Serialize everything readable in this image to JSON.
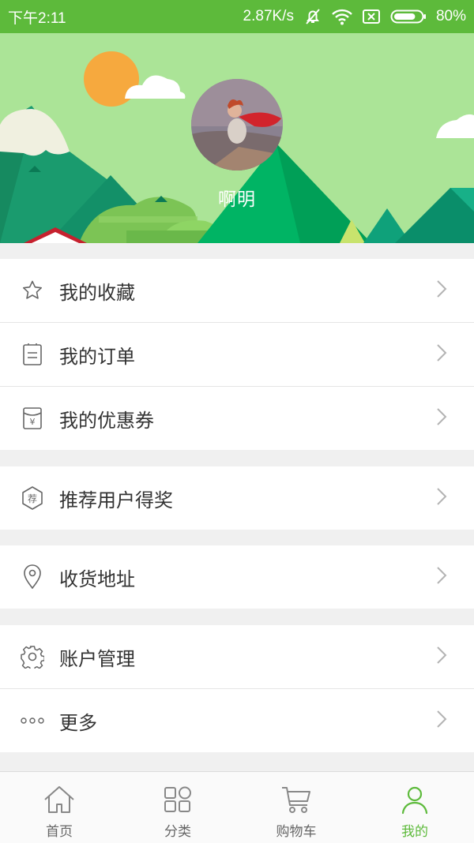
{
  "status_bar": {
    "time": "下午2:11",
    "network_speed": "2.87K/s",
    "battery": "80%",
    "battery_level": 0.8
  },
  "profile": {
    "username": "啊明"
  },
  "menu": {
    "favorites": "我的收藏",
    "orders": "我的订单",
    "coupons": "我的优惠券",
    "coupon_icon_char": "¥",
    "referral": "推荐用户得奖",
    "referral_icon_char": "荐",
    "address": "收货地址",
    "account": "账户管理",
    "more": "更多"
  },
  "tabs": {
    "home": "首页",
    "category": "分类",
    "cart": "购物车",
    "mine": "我的"
  },
  "colors": {
    "accent": "#5dba3b",
    "header_bg": "#abe497",
    "text": "#333333",
    "icon_gray": "#666666"
  }
}
